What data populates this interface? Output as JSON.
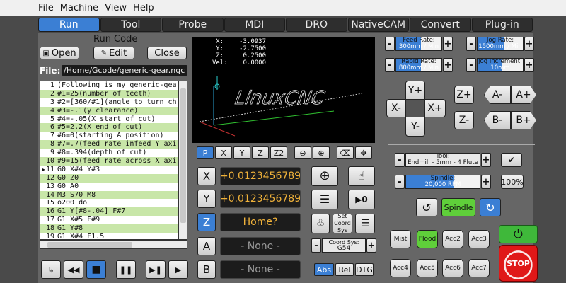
{
  "menu": [
    "File",
    "Machine",
    "View",
    "Help"
  ],
  "tabs": [
    "Run",
    "Tool",
    "Probe",
    "MDI",
    "DRO",
    "NativeCAM",
    "Convert",
    "Plug-in"
  ],
  "run_code": {
    "heading": "Run Code",
    "open": "Open",
    "edit": "Edit",
    "close": "Close"
  },
  "file": {
    "label": "File:",
    "path": "/Home/Gcode/generic-gear.ngc"
  },
  "code_lines": [
    {
      "n": "1",
      "t": "(Following is my generic-gear"
    },
    {
      "n": "2",
      "t": "#1=25(number of teeth)"
    },
    {
      "n": "3",
      "t": "#2=[360/#1](angle to turn ch"
    },
    {
      "n": "4",
      "t": "#3=-.1(y clearance)"
    },
    {
      "n": "5",
      "t": "#4=-.05(X start of cut)"
    },
    {
      "n": "6",
      "t": "#5=2.2(X end of cut)"
    },
    {
      "n": "7",
      "t": "#6=0(starting A position)"
    },
    {
      "n": "8",
      "t": "#7=.7(feed rate infeed Y axi"
    },
    {
      "n": "9",
      "t": "#8=.394(depth of cut)"
    },
    {
      "n": "10",
      "t": "#9=15(feed rate across X axi"
    },
    {
      "n": "11",
      "t": "G0 X#4 Y#3"
    },
    {
      "n": "12",
      "t": "G0 Z0"
    },
    {
      "n": "13",
      "t": "G0 A0"
    },
    {
      "n": "14",
      "t": "M3 S70 M8"
    },
    {
      "n": "15",
      "t": "o200 do"
    },
    {
      "n": "16",
      "t": "G1 Y[#8-.04] F#7"
    },
    {
      "n": "17",
      "t": "G1 X#5 F#9"
    },
    {
      "n": "18",
      "t": "G1 Y#8"
    },
    {
      "n": "19",
      "t": "G1 X#4 F1.5"
    }
  ],
  "readout": [
    {
      "k": "X:",
      "v": "-3.0937"
    },
    {
      "k": "Y:",
      "v": "-2.7500"
    },
    {
      "k": "Z:",
      "v": "0.2500"
    },
    {
      "k": "Vel:",
      "v": "0.0000"
    }
  ],
  "view_buttons": [
    "P",
    "X",
    "Y",
    "Z",
    "Z2"
  ],
  "dro": {
    "x_label": "X",
    "x_value": "+0.0123456789",
    "y_label": "Y",
    "y_value": "+0.0123456789",
    "z_label": "Z",
    "z_value": "Home?",
    "a_label": "A",
    "a_value": "- None -",
    "b_label": "B",
    "b_value": "- None -"
  },
  "coord_sys": {
    "label": "Coord Sys:",
    "value": "G54",
    "set_label": "Set Coord Sys"
  },
  "modes": [
    "Abs",
    "Rel",
    "DTG"
  ],
  "feed_rate": {
    "label": "Feed Rate:",
    "value": "300mm / Min",
    "level": 0.55
  },
  "rapid_rate": {
    "label": "Rapid Rate:",
    "value": "800mm / Min",
    "level": 0.55
  },
  "jog_rate": {
    "label": "Jog Rate:",
    "value": "1500mm / Min",
    "level": 0.6
  },
  "jog_increment": {
    "label": "Jog Increment:",
    "value": "10mm",
    "level": 0.55
  },
  "jog": {
    "yp": "Y+",
    "ym": "Y-",
    "xm": "X-",
    "xp": "X+",
    "zp": "Z+",
    "zm": "Z-",
    "am": "A-",
    "ap": "A+",
    "bm": "B-",
    "bp": "B+"
  },
  "tool": {
    "label": "Tool:",
    "value": "Endmill - 5mm - 4 Flute"
  },
  "spindle": {
    "label": "Spindle:",
    "value": "20,000 RPM",
    "percent": "100%",
    "button": "Spindle",
    "level": 0.65
  },
  "coolant": {
    "mist": "Mist",
    "flood": "Flood"
  },
  "aux": [
    "Acc2",
    "Acc3",
    "Acc4",
    "Acc5",
    "Acc6",
    "Acc7"
  ],
  "stop_label": "STOP",
  "preview_logo": "LinuxCNC",
  "colors": {
    "accent": "#3b7fd4",
    "dro_text": "#f0b23a",
    "stop": "#e01818",
    "power": "#3fb83a",
    "flood": "#5fcf3a",
    "highlight": "#c8e6a8"
  }
}
